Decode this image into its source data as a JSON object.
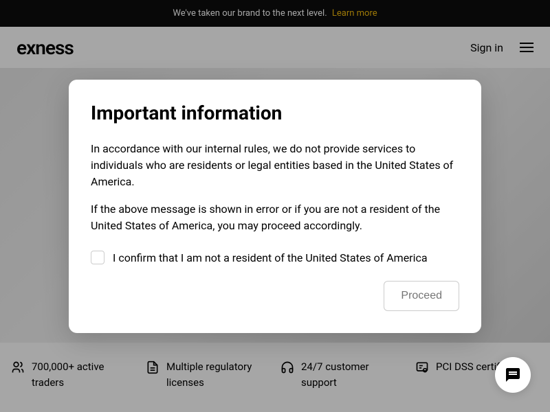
{
  "announcement": {
    "text": "We've taken our brand to the next level.",
    "link_text": "Learn more"
  },
  "header": {
    "logo": "exness",
    "sign_in": "Sign in"
  },
  "features": [
    {
      "text": "700,000+ active traders"
    },
    {
      "text": "Multiple regulatory licenses"
    },
    {
      "text": "24/7 customer support"
    },
    {
      "text": "PCI DSS certified"
    }
  ],
  "modal": {
    "title": "Important information",
    "paragraph1": "In accordance with our internal rules, we do not provide services to individuals who are residents or legal entities based in the United States of America.",
    "paragraph2": "If the above message is shown in error or if you are not a resident of the United States of America, you may proceed accordingly.",
    "checkbox_label": "I confirm that I am not a resident of the United States of America",
    "proceed_label": "Proceed"
  }
}
